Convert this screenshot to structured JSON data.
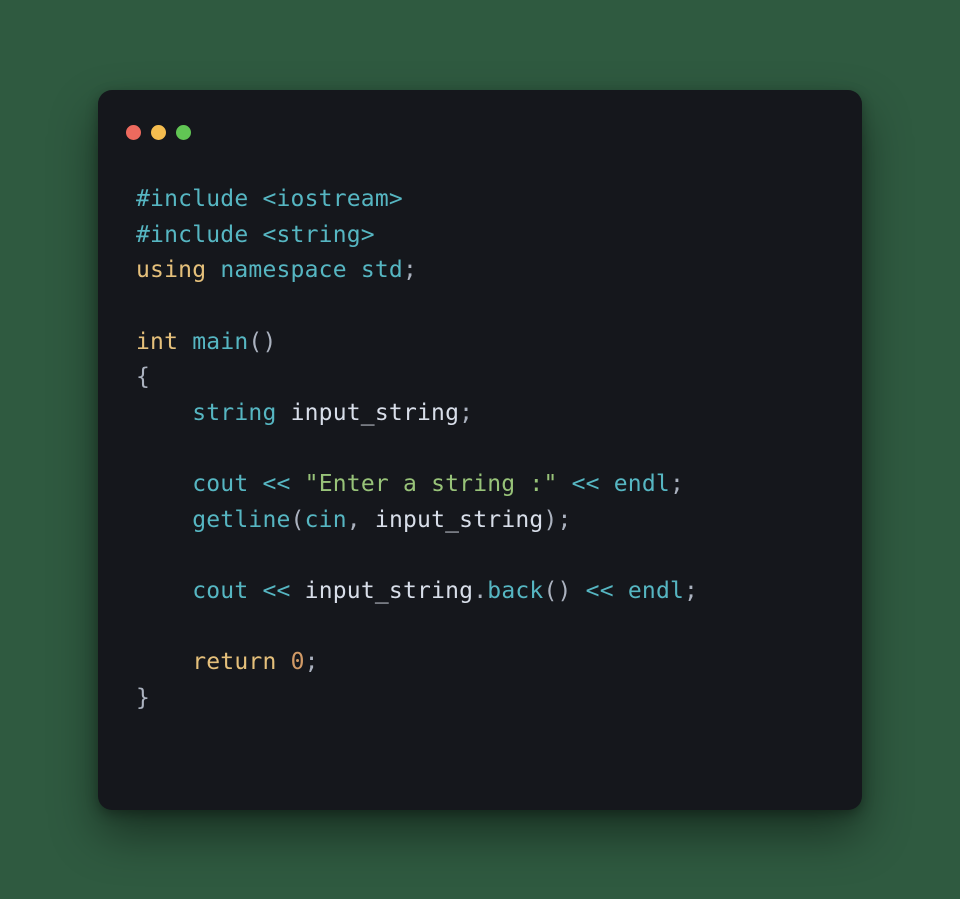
{
  "code": {
    "include1_pp": "#include",
    "include1_hdr": "<iostream>",
    "include2_pp": "#include",
    "include2_hdr": "<string>",
    "using_kw": "using",
    "namespace_kw": "namespace",
    "std": "std",
    "semicolon": ";",
    "int_kw": "int",
    "main_fn": "main",
    "paren_open": "(",
    "paren_close": ")",
    "brace_open": "{",
    "brace_close": "}",
    "indent": "    ",
    "string_type": "string",
    "var": "input_string",
    "cout": "cout",
    "cin": "cin",
    "endl": "endl",
    "op_stream": "<<",
    "str_literal": "\"Enter a string :\"",
    "getline_fn": "getline",
    "comma": ",",
    "dot": ".",
    "back_fn": "back",
    "return_kw": "return",
    "zero": "0"
  }
}
